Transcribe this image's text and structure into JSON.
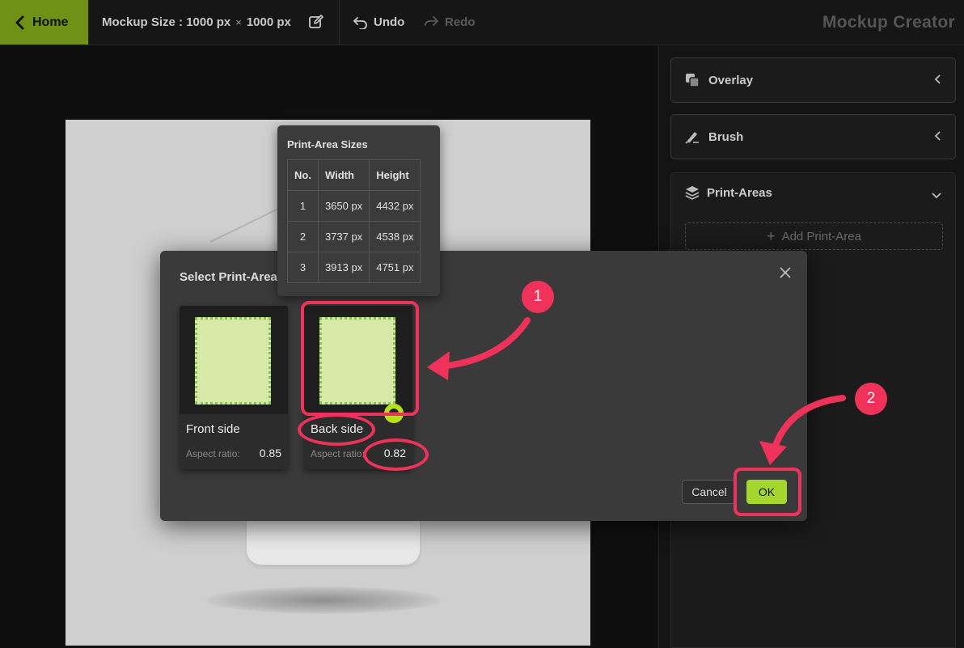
{
  "topbar": {
    "home_label": "Home",
    "mockup_size_label": "Mockup Size :",
    "mockup_width": "1000 px",
    "times": "×",
    "mockup_height": "1000 px",
    "undo_label": "Undo",
    "redo_label": "Redo",
    "app_title": "Mockup Creator",
    "accent_color": "#6f9216"
  },
  "right_panel": {
    "overlay_label": "Overlay",
    "brush_label": "Brush",
    "print_areas_label": "Print-Areas",
    "add_print_area_label": "Add Print-Area"
  },
  "tooltip": {
    "title": "Print-Area Sizes",
    "headers": [
      "No.",
      "Width",
      "Height"
    ],
    "rows": [
      [
        "1",
        "3650 px",
        "4432 px"
      ],
      [
        "2",
        "3737 px",
        "4538 px"
      ],
      [
        "3",
        "3913 px",
        "4751 px"
      ]
    ]
  },
  "modal": {
    "title": "Select Print-Area",
    "cards": [
      {
        "name": "Front side",
        "ar_label": "Aspect ratio:",
        "ar_value": "0.85"
      },
      {
        "name": "Back side",
        "ar_label": "Aspect ratio:",
        "ar_value": "0.82"
      }
    ],
    "cancel_label": "Cancel",
    "ok_label": "OK",
    "ok_color": "#a3d72d"
  },
  "annotations": {
    "badge_1": "1",
    "badge_2": "2",
    "highlight_color": "#f0325a"
  }
}
